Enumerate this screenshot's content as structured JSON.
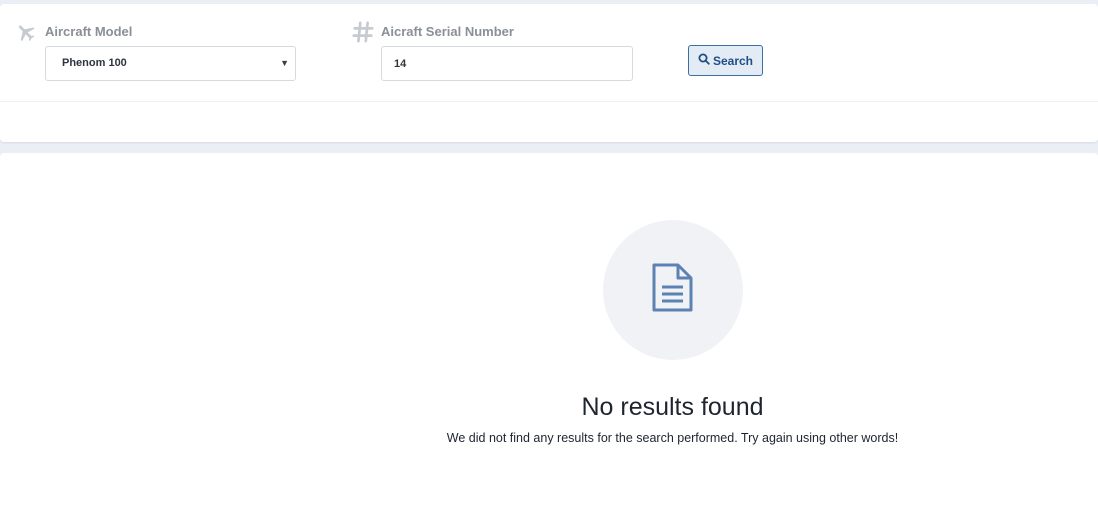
{
  "search": {
    "model_label": "Aircraft Model",
    "model_selected": "Phenom 100",
    "serial_label": "Aicraft Serial Number",
    "serial_value": "14",
    "button_label": "Search"
  },
  "results": {
    "title": "No results found",
    "message": "We did not find any results for the search performed. Try again using other words!"
  },
  "icons": {
    "model": "airplane-icon",
    "serial": "hash-icon",
    "button": "search-icon",
    "empty": "document-icon"
  },
  "colors": {
    "accent": "#1f4f86",
    "icon_blue": "#5b82b3",
    "muted_label": "#8a8f98"
  }
}
